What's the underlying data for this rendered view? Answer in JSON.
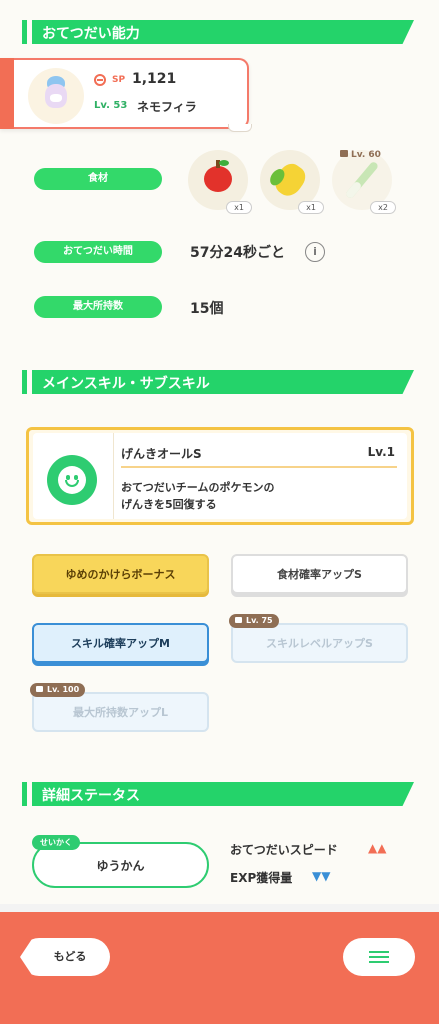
{
  "sections": {
    "help_ability": "おてつだい能力",
    "skills": "メインスキル・サブスキル",
    "status": "詳細ステータス"
  },
  "pokemon": {
    "sp_label": "SP",
    "sp_value": "1,121",
    "level": "Lv. 53",
    "name": "ネモフィラ"
  },
  "ability": {
    "ingredients_label": "食材",
    "ingredients": [
      {
        "icon": "apple-icon",
        "qty": "x1"
      },
      {
        "icon": "corn-icon",
        "qty": "x1"
      },
      {
        "icon": "leek-icon",
        "qty": "x2",
        "lock": "Lv. 60"
      }
    ],
    "help_time_label": "おてつだい時間",
    "help_time_value": "57分24秒ごと",
    "max_carry_label": "最大所持数",
    "max_carry_value": "15個"
  },
  "main_skill": {
    "name": "げんきオールS",
    "level": "Lv.1",
    "desc_line1": "おてつだいチームのポケモンの",
    "desc_line2": "げんきを5回復する"
  },
  "sub_skills": [
    {
      "label": "ゆめのかけらボーナス"
    },
    {
      "label": "食材確率アップS"
    },
    {
      "label": "スキル確率アップM"
    },
    {
      "label": "スキルレベルアップS",
      "lock": "Lv. 75"
    },
    {
      "label": "最大所持数アップL",
      "lock": "Lv. 100"
    }
  ],
  "status": {
    "nature_tag": "せいかく",
    "nature_value": "ゆうかん",
    "up_label": "おてつだいスピード",
    "up_marks": "▲▲",
    "down_label": "EXP獲得量",
    "down_marks": "▼▼"
  },
  "footer": {
    "back_label": "もどる"
  },
  "colors": {
    "accent_green": "#24d36a",
    "accent_orange": "#f26e55",
    "gold": "#f8d65a",
    "blue": "#3a8fd6"
  }
}
